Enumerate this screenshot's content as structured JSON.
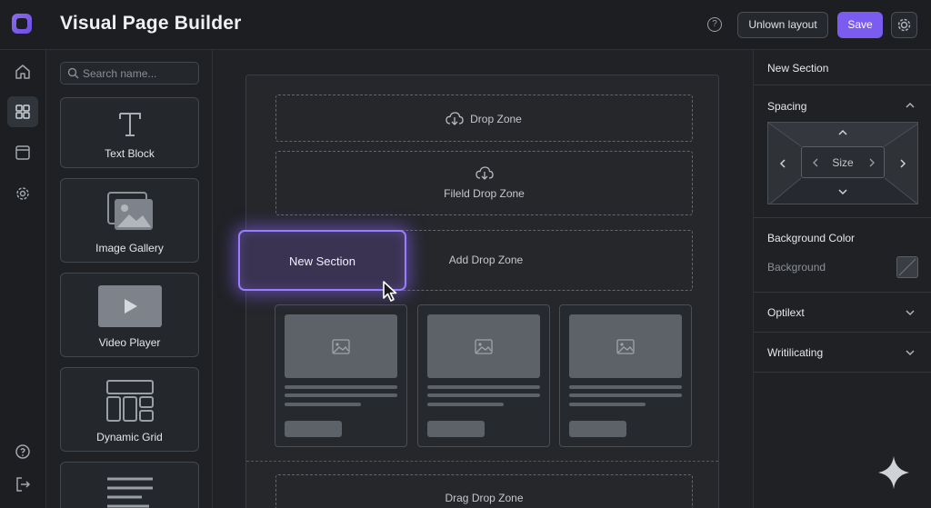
{
  "header": {
    "title": "Visual Page Builder",
    "layout_button": "Unlown layout",
    "save_button": "Save"
  },
  "rail": {
    "icons": [
      "home-icon",
      "grid-icon",
      "window-icon",
      "gear-icon",
      "help-icon",
      "logout-icon"
    ],
    "active_index": 1
  },
  "widgets": {
    "search_placeholder": "Search name...",
    "items": [
      {
        "label": "Text Block",
        "icon": "text-icon"
      },
      {
        "label": "Image Gallery",
        "icon": "gallery-icon"
      },
      {
        "label": "Video Player",
        "icon": "video-icon"
      },
      {
        "label": "Dynamic Grid",
        "icon": "layout-grid-icon"
      },
      {
        "label": "",
        "icon": "text-lines-icon"
      }
    ]
  },
  "canvas": {
    "zone1": "Drop Zone",
    "zone2": "Fileld Drop Zone",
    "zone3": "Add Drop Zone",
    "zone4": "Drag Drop Zone",
    "dragged_section": "New Section",
    "column_count": 3
  },
  "props": {
    "title": "New Section",
    "spacing": {
      "title": "Spacing",
      "size_label": "Size",
      "expanded": true
    },
    "background": {
      "title": "Background Color",
      "label": "Background"
    },
    "sections": [
      {
        "title": "Optilext",
        "expanded": false
      },
      {
        "title": "Writilicating",
        "expanded": false
      }
    ]
  },
  "colors": {
    "accent": "#7b5cf0",
    "background": "#1c1e22",
    "panel": "#1f2125"
  }
}
